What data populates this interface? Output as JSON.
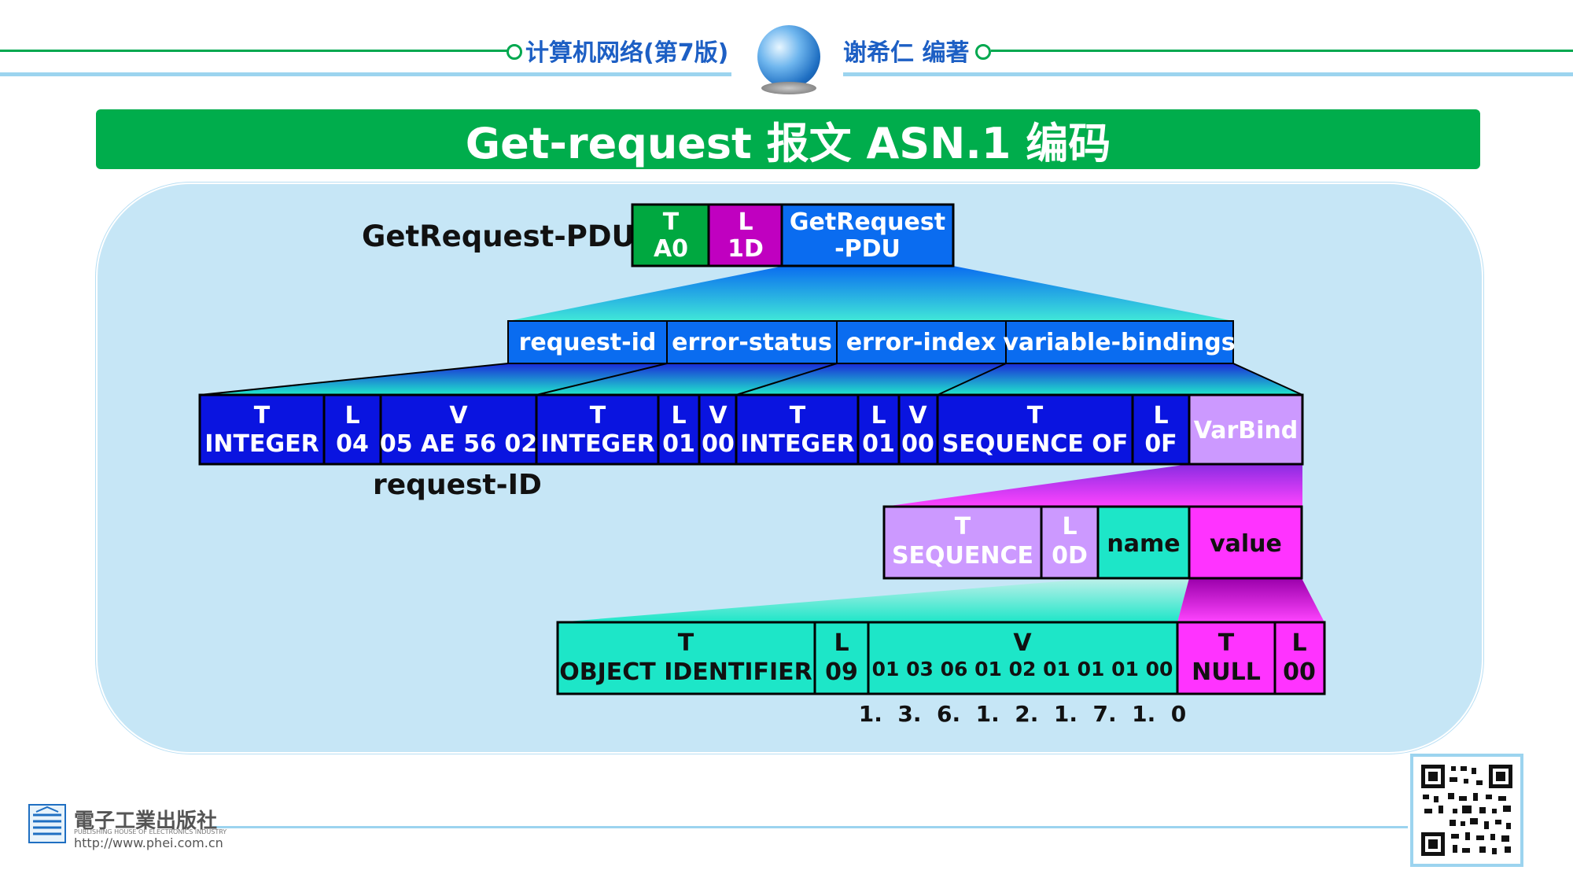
{
  "header": {
    "book": "计算机网络(第7版)",
    "author": "谢希仁 编著"
  },
  "title": "Get-request 报文 ASN.1 编码",
  "pdu_label": "GetRequest-PDU",
  "pdu_cells": [
    {
      "line1": "T",
      "line2": "A0"
    },
    {
      "line1": "L",
      "line2": "1D"
    },
    {
      "line1": "GetRequest",
      "line2": "-PDU"
    }
  ],
  "fields": [
    "request-id",
    "error-status",
    "error-index",
    "variable-bindings"
  ],
  "row3": [
    {
      "line1": "T",
      "line2": "INTEGER"
    },
    {
      "line1": "L",
      "line2": "04"
    },
    {
      "line1": "V",
      "line2": "05 AE 56 02"
    },
    {
      "line1": "T",
      "line2": "INTEGER"
    },
    {
      "line1": "L",
      "line2": "01"
    },
    {
      "line1": "V",
      "line2": "00"
    },
    {
      "line1": "T",
      "line2": "INTEGER"
    },
    {
      "line1": "L",
      "line2": "01"
    },
    {
      "line1": "V",
      "line2": "00"
    },
    {
      "line1": "T",
      "line2": "SEQUENCE OF"
    },
    {
      "line1": "L",
      "line2": "0F"
    },
    {
      "line1": "VarBind",
      "line2": ""
    }
  ],
  "request_id_label": "request-ID",
  "varbind_cells": [
    {
      "line1": "T",
      "line2": "SEQUENCE"
    },
    {
      "line1": "L",
      "line2": "0D"
    },
    {
      "line1": "name",
      "line2": ""
    },
    {
      "line1": "value",
      "line2": ""
    }
  ],
  "row5": [
    {
      "line1": "T",
      "line2": "OBJECT IDENTIFIER"
    },
    {
      "line1": "L",
      "line2": "09"
    },
    {
      "line1": "V",
      "line2": "01 03 06 01 02 01 01 01 00"
    },
    {
      "line1": "T",
      "line2": "NULL"
    },
    {
      "line1": "L",
      "line2": "00"
    }
  ],
  "oid_label": "1.  3.  6.  1.  2.  1.  7.  1.  0",
  "footer": {
    "publisher": "電子工業出版社",
    "publisher_en": "PUBLISHING HOUSE OF ELECTRONICS INDUSTRY",
    "url": "http://www.phei.com.cn"
  },
  "colors": {
    "green": "#00ad4c",
    "purple": "#c000c0",
    "blue": "#0a6cf0",
    "dark_blue": "#0a14e0",
    "cyan": "#1de6c8",
    "lavender": "#cc99ff",
    "magenta": "#ff33ff"
  }
}
